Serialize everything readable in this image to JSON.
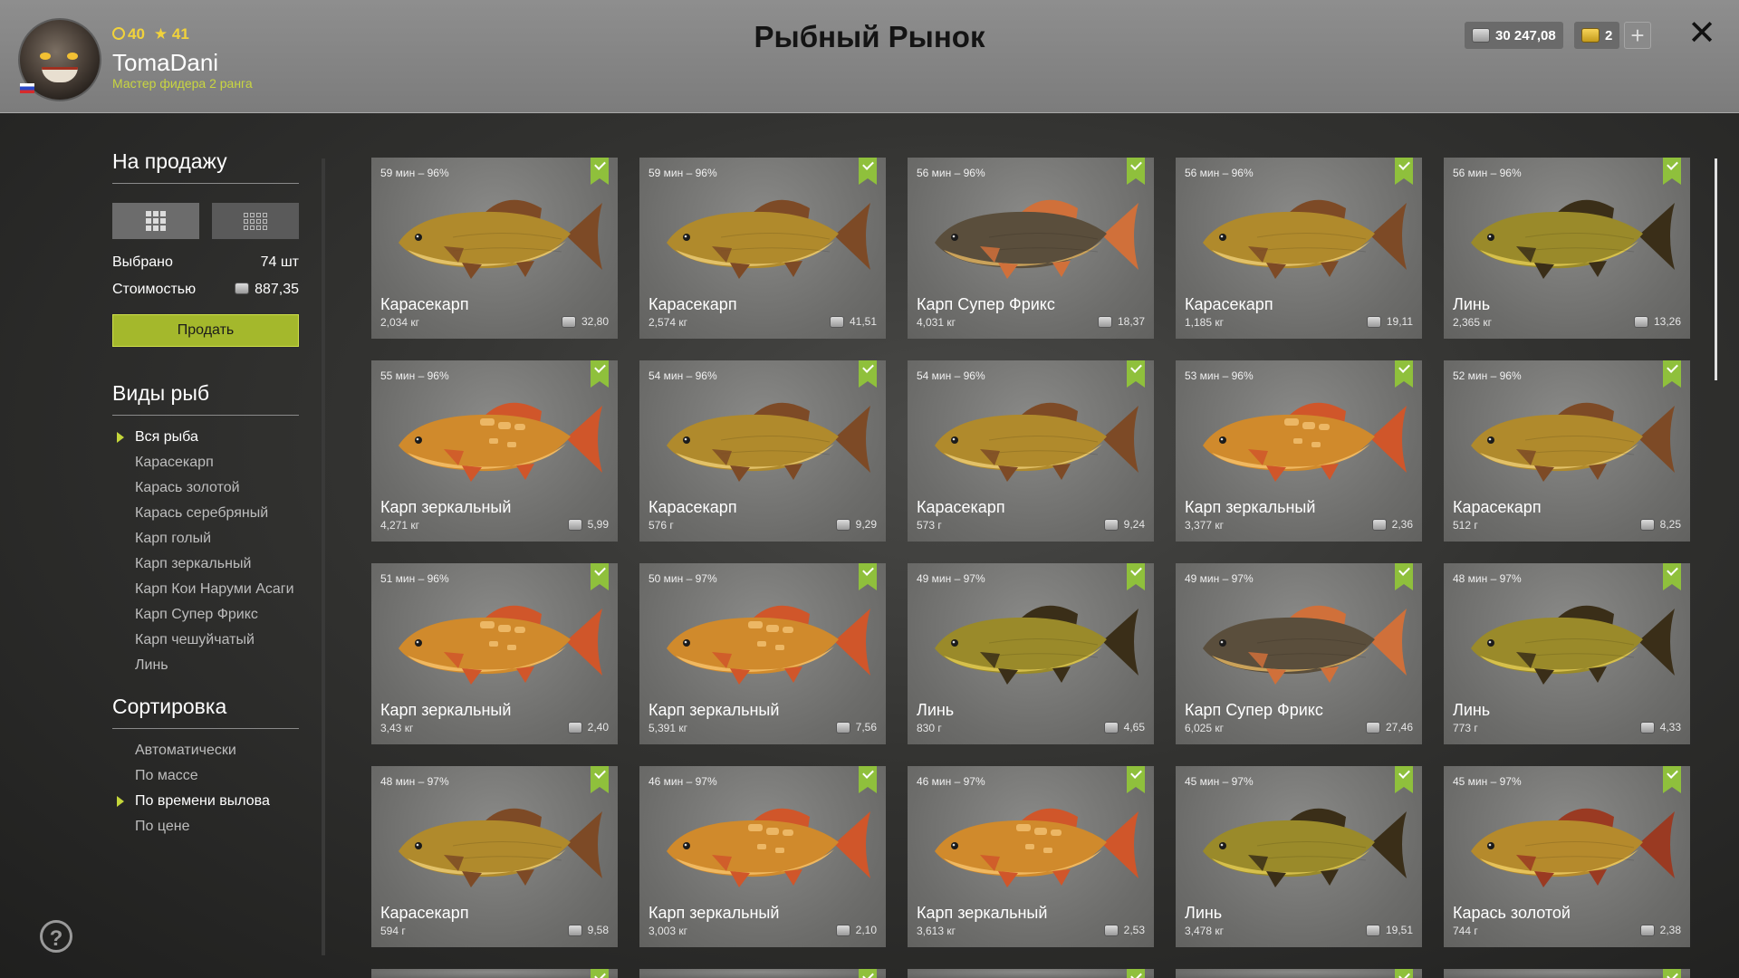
{
  "header": {
    "title": "Рыбный Рынок",
    "player": {
      "name": "TomaDani",
      "rank": "Мастер фидера 2 ранга",
      "level": "40",
      "stars": "41"
    },
    "silver": "30 247,08",
    "gold": "2",
    "plus_label": "+",
    "close_label": "✕"
  },
  "sidebar": {
    "sale_title": "На продажу",
    "selected_label": "Выбрано",
    "selected_value": "74 шт",
    "cost_label": "Стоимостью",
    "cost_value": "887,35",
    "sell_button": "Продать",
    "species_title": "Виды рыб",
    "species": [
      "Вся рыба",
      "Карасекарп",
      "Карась золотой",
      "Карась серебряный",
      "Карп голый",
      "Карп зеркальный",
      "Карп Кои Наруми Асаги",
      "Карп Супер Фрикс",
      "Карп чешуйчатый",
      "Линь"
    ],
    "sort_title": "Сортировка",
    "sort": [
      "Автоматически",
      "По массе",
      "По времени вылова",
      "По цене"
    ],
    "help_label": "?"
  },
  "cards": [
    {
      "time": "59 мин – 96%",
      "name": "Карасекарп",
      "weight": "2,034 кг",
      "price": "32,80"
    },
    {
      "time": "59 мин – 96%",
      "name": "Карасекарп",
      "weight": "2,574 кг",
      "price": "41,51"
    },
    {
      "time": "56 мин – 96%",
      "name": "Карп Супер Фрикс",
      "weight": "4,031 кг",
      "price": "18,37"
    },
    {
      "time": "56 мин – 96%",
      "name": "Карасекарп",
      "weight": "1,185 кг",
      "price": "19,11"
    },
    {
      "time": "56 мин – 96%",
      "name": "Линь",
      "weight": "2,365 кг",
      "price": "13,26"
    },
    {
      "time": "55 мин – 96%",
      "name": "Карп зеркальный",
      "weight": "4,271 кг",
      "price": "5,99"
    },
    {
      "time": "54 мин – 96%",
      "name": "Карасекарп",
      "weight": "576 г",
      "price": "9,29"
    },
    {
      "time": "54 мин – 96%",
      "name": "Карасекарп",
      "weight": "573 г",
      "price": "9,24"
    },
    {
      "time": "53 мин – 96%",
      "name": "Карп зеркальный",
      "weight": "3,377 кг",
      "price": "2,36"
    },
    {
      "time": "52 мин – 96%",
      "name": "Карасекарп",
      "weight": "512 г",
      "price": "8,25"
    },
    {
      "time": "51 мин – 96%",
      "name": "Карп зеркальный",
      "weight": "3,43 кг",
      "price": "2,40"
    },
    {
      "time": "50 мин – 97%",
      "name": "Карп зеркальный",
      "weight": "5,391 кг",
      "price": "7,56"
    },
    {
      "time": "49 мин – 97%",
      "name": "Линь",
      "weight": "830 г",
      "price": "4,65"
    },
    {
      "time": "49 мин – 97%",
      "name": "Карп Супер Фрикс",
      "weight": "6,025 кг",
      "price": "27,46"
    },
    {
      "time": "48 мин – 97%",
      "name": "Линь",
      "weight": "773 г",
      "price": "4,33"
    },
    {
      "time": "48 мин – 97%",
      "name": "Карасекарп",
      "weight": "594 г",
      "price": "9,58"
    },
    {
      "time": "46 мин – 97%",
      "name": "Карп зеркальный",
      "weight": "3,003 кг",
      "price": "2,10"
    },
    {
      "time": "46 мин – 97%",
      "name": "Карп зеркальный",
      "weight": "3,613 кг",
      "price": "2,53"
    },
    {
      "time": "45 мин – 97%",
      "name": "Линь",
      "weight": "3,478 кг",
      "price": "19,51"
    },
    {
      "time": "45 мин – 97%",
      "name": "Карась золотой",
      "weight": "744 г",
      "price": "2,38"
    }
  ],
  "colors": {
    "accent": "#a4b82c",
    "checkmark": "#8fc03c",
    "gold_text": "#f1d23b",
    "rank_text": "#c9d640"
  },
  "fish_palette": {
    "Карасекарп": {
      "body": "#b08a2c",
      "belly": "#e2c168",
      "fin": "#7d4a26"
    },
    "Карп зеркальный": {
      "body": "#d08a2c",
      "belly": "#f0b860",
      "fin": "#d0562a"
    },
    "Карп Супер Фрикс": {
      "body": "#5a4e3c",
      "belly": "#caa25a",
      "fin": "#d0703a"
    },
    "Линь": {
      "body": "#9a8a2a",
      "belly": "#d6c04c",
      "fin": "#3a2e18"
    },
    "Карась золотой": {
      "body": "#b58a2c",
      "belly": "#e6c25a",
      "fin": "#9a3a22"
    }
  }
}
